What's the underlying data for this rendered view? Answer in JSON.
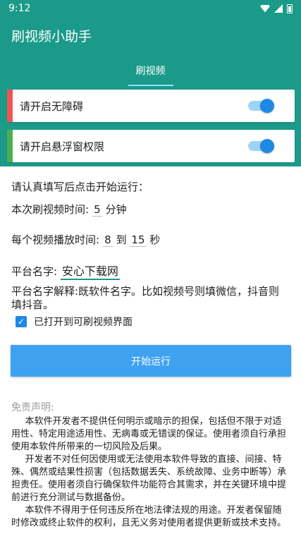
{
  "status": {
    "time": "9:12"
  },
  "app": {
    "title": "刷视频小助手"
  },
  "tabs": [
    {
      "label": "刷视频"
    }
  ],
  "colors": {
    "accent": "#1b9a8a",
    "button": "#3ea2f0",
    "switch": "#1e88e5",
    "card1_bar": "#f05454",
    "card2_bar": "#4caf50"
  },
  "cards": [
    {
      "label": "请开启无障碍",
      "enabled": true
    },
    {
      "label": "请开启悬浮窗权限",
      "enabled": true
    }
  ],
  "form": {
    "intro": "请认真填写后点击开始运行：",
    "duration_prefix": "本次刷视频时间:",
    "duration_value": "5",
    "duration_unit": "分钟",
    "play_prefix": "每个视频播放时间:",
    "play_min": "8",
    "play_to": "到",
    "play_max": "15",
    "play_unit": "秒",
    "platform_prefix": "平台名字:",
    "platform_value": "安心下载网",
    "platform_explain": "平台名字解释:既软件名字。比如视频号则填微信，抖音则填抖音。",
    "checkbox_label": "已打开到可刷视频界面",
    "checkbox_checked": true
  },
  "start_button": {
    "label": "开始运行"
  },
  "disclaimer": {
    "title": "免责声明:",
    "paragraphs": [
      "本软件开发者不提供任何明示或暗示的担保，包括但不限于对适用性、特定用途适用性、无病毒或无错误的保证。使用者须自行承担使用本软件所带来的一切风险及后果。",
      "开发者不对任何因使用或无法使用本软件导致的直接、间接、特殊、偶然或结果性损害（包括数据丢失、系统故障、业务中断等）承担责任。使用者须自行确保软件功能符合其需求，并在关键环境中提前进行充分测试与数据备份。",
      "本软件不得用于任何违反所在地法律法规的用途。开发者保留随时修改或终止软件的权利，且无义务对使用者提供更新或技术支持。"
    ]
  }
}
